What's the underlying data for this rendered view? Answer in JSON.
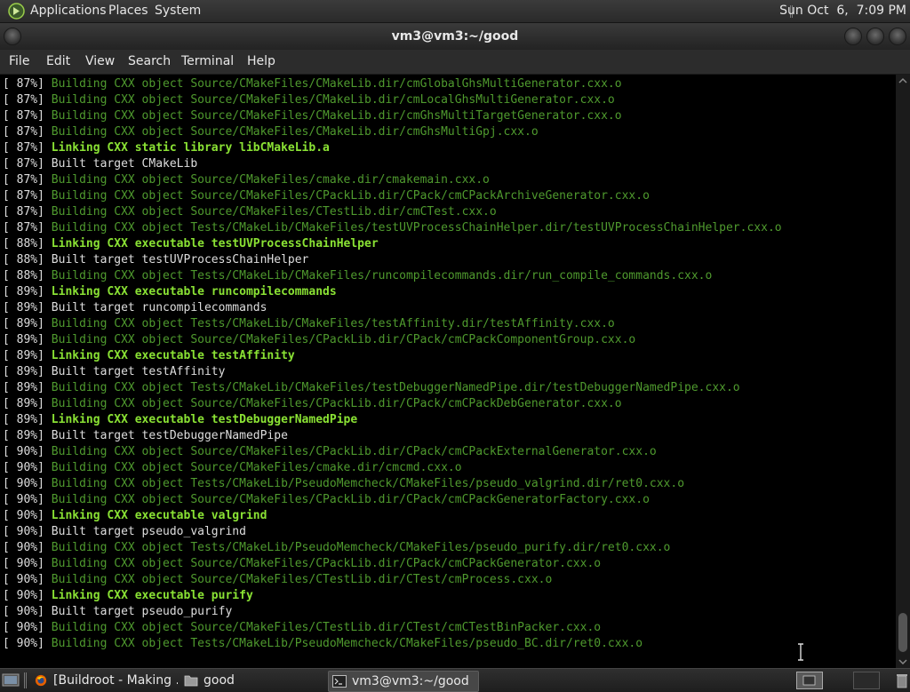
{
  "top_panel": {
    "menus": [
      "Applications",
      "Places",
      "System"
    ],
    "clock": "Sun Oct  6,  7:09 PM"
  },
  "window": {
    "title": "vm3@vm3:~/good"
  },
  "menubar": [
    "File",
    "Edit",
    "View",
    "Search",
    "Terminal",
    "Help"
  ],
  "terminal": {
    "colors": {
      "build": "#4f9a2e",
      "link": "#8ae234",
      "built": "#dedede",
      "background": "#000000"
    },
    "lines": [
      {
        "pct": "[ 87%]",
        "type": "build",
        "text": "Building CXX object Source/CMakeFiles/CMakeLib.dir/cmGlobalGhsMultiGenerator.cxx.o"
      },
      {
        "pct": "[ 87%]",
        "type": "build",
        "text": "Building CXX object Source/CMakeFiles/CMakeLib.dir/cmLocalGhsMultiGenerator.cxx.o"
      },
      {
        "pct": "[ 87%]",
        "type": "build",
        "text": "Building CXX object Source/CMakeFiles/CMakeLib.dir/cmGhsMultiTargetGenerator.cxx.o"
      },
      {
        "pct": "[ 87%]",
        "type": "build",
        "text": "Building CXX object Source/CMakeFiles/CMakeLib.dir/cmGhsMultiGpj.cxx.o"
      },
      {
        "pct": "[ 87%]",
        "type": "link",
        "text": "Linking CXX static library libCMakeLib.a"
      },
      {
        "pct": "[ 87%]",
        "type": "built",
        "text": "Built target CMakeLib"
      },
      {
        "pct": "[ 87%]",
        "type": "build",
        "text": "Building CXX object Source/CMakeFiles/cmake.dir/cmakemain.cxx.o"
      },
      {
        "pct": "[ 87%]",
        "type": "build",
        "text": "Building CXX object Source/CMakeFiles/CPackLib.dir/CPack/cmCPackArchiveGenerator.cxx.o"
      },
      {
        "pct": "[ 87%]",
        "type": "build",
        "text": "Building CXX object Source/CMakeFiles/CTestLib.dir/cmCTest.cxx.o"
      },
      {
        "pct": "[ 87%]",
        "type": "build",
        "text": "Building CXX object Tests/CMakeLib/CMakeFiles/testUVProcessChainHelper.dir/testUVProcessChainHelper.cxx.o"
      },
      {
        "pct": "[ 88%]",
        "type": "link",
        "text": "Linking CXX executable testUVProcessChainHelper"
      },
      {
        "pct": "[ 88%]",
        "type": "built",
        "text": "Built target testUVProcessChainHelper"
      },
      {
        "pct": "[ 88%]",
        "type": "build",
        "text": "Building CXX object Tests/CMakeLib/CMakeFiles/runcompilecommands.dir/run_compile_commands.cxx.o"
      },
      {
        "pct": "[ 89%]",
        "type": "link",
        "text": "Linking CXX executable runcompilecommands"
      },
      {
        "pct": "[ 89%]",
        "type": "built",
        "text": "Built target runcompilecommands"
      },
      {
        "pct": "[ 89%]",
        "type": "build",
        "text": "Building CXX object Tests/CMakeLib/CMakeFiles/testAffinity.dir/testAffinity.cxx.o"
      },
      {
        "pct": "[ 89%]",
        "type": "build",
        "text": "Building CXX object Source/CMakeFiles/CPackLib.dir/CPack/cmCPackComponentGroup.cxx.o"
      },
      {
        "pct": "[ 89%]",
        "type": "link",
        "text": "Linking CXX executable testAffinity"
      },
      {
        "pct": "[ 89%]",
        "type": "built",
        "text": "Built target testAffinity"
      },
      {
        "pct": "[ 89%]",
        "type": "build",
        "text": "Building CXX object Tests/CMakeLib/CMakeFiles/testDebuggerNamedPipe.dir/testDebuggerNamedPipe.cxx.o"
      },
      {
        "pct": "[ 89%]",
        "type": "build",
        "text": "Building CXX object Source/CMakeFiles/CPackLib.dir/CPack/cmCPackDebGenerator.cxx.o"
      },
      {
        "pct": "[ 89%]",
        "type": "link",
        "text": "Linking CXX executable testDebuggerNamedPipe"
      },
      {
        "pct": "[ 89%]",
        "type": "built",
        "text": "Built target testDebuggerNamedPipe"
      },
      {
        "pct": "[ 90%]",
        "type": "build",
        "text": "Building CXX object Source/CMakeFiles/CPackLib.dir/CPack/cmCPackExternalGenerator.cxx.o"
      },
      {
        "pct": "[ 90%]",
        "type": "build",
        "text": "Building CXX object Source/CMakeFiles/cmake.dir/cmcmd.cxx.o"
      },
      {
        "pct": "[ 90%]",
        "type": "build",
        "text": "Building CXX object Tests/CMakeLib/PseudoMemcheck/CMakeFiles/pseudo_valgrind.dir/ret0.cxx.o"
      },
      {
        "pct": "[ 90%]",
        "type": "build",
        "text": "Building CXX object Source/CMakeFiles/CPackLib.dir/CPack/cmCPackGeneratorFactory.cxx.o"
      },
      {
        "pct": "[ 90%]",
        "type": "link",
        "text": "Linking CXX executable valgrind"
      },
      {
        "pct": "[ 90%]",
        "type": "built",
        "text": "Built target pseudo_valgrind"
      },
      {
        "pct": "[ 90%]",
        "type": "build",
        "text": "Building CXX object Tests/CMakeLib/PseudoMemcheck/CMakeFiles/pseudo_purify.dir/ret0.cxx.o"
      },
      {
        "pct": "[ 90%]",
        "type": "build",
        "text": "Building CXX object Source/CMakeFiles/CPackLib.dir/CPack/cmCPackGenerator.cxx.o"
      },
      {
        "pct": "[ 90%]",
        "type": "build",
        "text": "Building CXX object Source/CMakeFiles/CTestLib.dir/CTest/cmProcess.cxx.o"
      },
      {
        "pct": "[ 90%]",
        "type": "link",
        "text": "Linking CXX executable purify"
      },
      {
        "pct": "[ 90%]",
        "type": "built",
        "text": "Built target pseudo_purify"
      },
      {
        "pct": "[ 90%]",
        "type": "build",
        "text": "Building CXX object Source/CMakeFiles/CTestLib.dir/CTest/cmCTestBinPacker.cxx.o"
      },
      {
        "pct": "[ 90%]",
        "type": "build",
        "text": "Building CXX object Tests/CMakeLib/PseudoMemcheck/CMakeFiles/pseudo_BC.dir/ret0.cxx.o"
      }
    ]
  },
  "taskbar": {
    "tasks": [
      {
        "label": "[Buildroot - Making ...",
        "icon": "firefox-icon",
        "active": false
      },
      {
        "label": "good",
        "icon": "folder-icon",
        "active": false
      },
      {
        "label": "vm3@vm3:~/good",
        "icon": "terminal-icon",
        "active": true
      }
    ]
  }
}
